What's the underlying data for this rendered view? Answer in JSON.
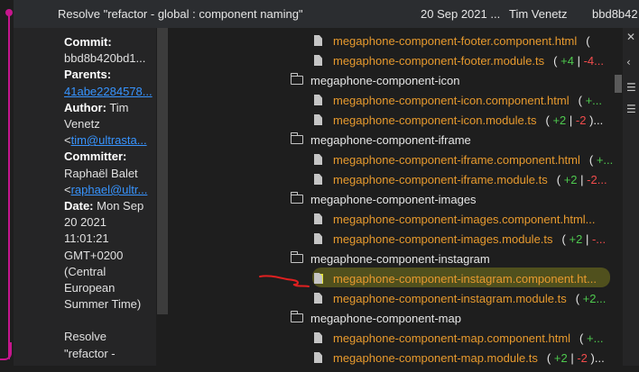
{
  "commit_row": {
    "message": "Resolve \"refactor - global : component naming\"",
    "date": "20 Sep 2021 ...",
    "author": "Tim Venetz",
    "hash": "bbd8b42"
  },
  "details": {
    "commit_label": "Commit:",
    "commit_value": "bbd8b420bd1...",
    "parents_label": "Parents:",
    "parents_value": "41abe2284578...",
    "author_label": "Author:",
    "author_name_1": "Tim",
    "author_name_2": "Venetz",
    "author_email": "<tim@ultrasta...",
    "committer_label": "Committer:",
    "committer_name": "Raphaël Balet",
    "committer_email": "<raphael@ultr...",
    "date_label": "Date:",
    "date_value_1": "Mon Sep",
    "date_value_2": "20 2021",
    "date_value_3": "11:01:21",
    "date_value_4": "GMT+0200",
    "date_value_5": "(Central",
    "date_value_6": "European",
    "date_value_7": "Summer Time)",
    "message_1": "Resolve",
    "message_2": "\"refactor -"
  },
  "files": {
    "rows": [
      {
        "type": "file",
        "name": "megaphone-component-footer.component.html",
        "plus": "",
        "minus": "",
        "pre": "(",
        "post": ""
      },
      {
        "type": "file",
        "name": "megaphone-component-footer.module.ts",
        "plus": "+4",
        "minus": "-4...",
        "pre": "(",
        "post": ""
      },
      {
        "type": "folder",
        "name": "megaphone-component-icon"
      },
      {
        "type": "file",
        "name": "megaphone-component-icon.component.html",
        "plus": "+...",
        "minus": "",
        "pre": "(",
        "post": ""
      },
      {
        "type": "file",
        "name": "megaphone-component-icon.module.ts",
        "plus": "+2",
        "minus": "-2",
        "pre": "(",
        "post": ")..."
      },
      {
        "type": "folder",
        "name": "megaphone-component-iframe"
      },
      {
        "type": "file",
        "name": "megaphone-component-iframe.component.html",
        "plus": "+...",
        "minus": "",
        "pre": "(",
        "post": ""
      },
      {
        "type": "file",
        "name": "megaphone-component-iframe.module.ts",
        "plus": "+2",
        "minus": "-2...",
        "pre": "(",
        "post": ""
      },
      {
        "type": "folder",
        "name": "megaphone-component-images"
      },
      {
        "type": "file",
        "name": "megaphone-component-images.component.html...",
        "plus": "",
        "minus": "",
        "pre": "",
        "post": ""
      },
      {
        "type": "file",
        "name": "megaphone-component-images.module.ts",
        "plus": "+2",
        "minus": "-...",
        "pre": "(",
        "post": ""
      },
      {
        "type": "folder",
        "name": "megaphone-component-instagram"
      },
      {
        "type": "file",
        "name": "megaphone-component-instagram.component.ht...",
        "plus": "",
        "minus": "",
        "pre": "",
        "post": ""
      },
      {
        "type": "file",
        "name": "megaphone-component-instagram.module.ts",
        "plus": "+2...",
        "minus": "",
        "pre": "(",
        "post": ""
      },
      {
        "type": "folder",
        "name": "megaphone-component-map"
      },
      {
        "type": "file",
        "name": "megaphone-component-map.component.html",
        "plus": "+...",
        "minus": "",
        "pre": "(",
        "post": ""
      },
      {
        "type": "file",
        "name": "megaphone-component-map.module.ts",
        "plus": "+2",
        "minus": "-2",
        "pre": "(",
        "post": ")..."
      }
    ]
  },
  "colors": {
    "accent": "#c6168d",
    "file_name": "#e79a2e",
    "additions": "#4ec94e",
    "deletions": "#f14c4c",
    "highlight": "#e3e33a"
  },
  "icons": {
    "folder": "folder-icon",
    "file": "file-icon",
    "close": "close-icon",
    "tree_view": "tree-view-icon",
    "list_view": "list-view-icon"
  }
}
